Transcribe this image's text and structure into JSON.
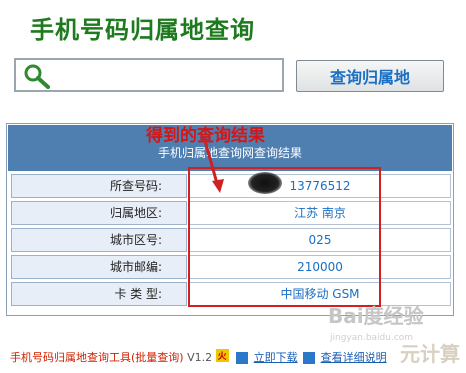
{
  "header": {
    "title": "手机号码归属地查询"
  },
  "search": {
    "value": "",
    "placeholder": "",
    "button_label": "查询归属地"
  },
  "result": {
    "heading": "手机归属地查询网查询结果",
    "rows": [
      {
        "label": "所查号码:",
        "value": "13776512"
      },
      {
        "label": "归属地区:",
        "value": "江苏 南京"
      },
      {
        "label": "城市区号:",
        "value": "025"
      },
      {
        "label": "城市邮编:",
        "value": "210000"
      },
      {
        "label": "卡 类 型:",
        "value": "中国移动 GSM"
      }
    ]
  },
  "annotation": {
    "text": "得到的查询结果",
    "color": "#d02020"
  },
  "footer": {
    "tool_name": "手机号码归属地查询工具(批量查询)",
    "version": "V1.2",
    "badge": "火",
    "download_link": "立即下载",
    "details_link": "查看详细说明"
  },
  "watermark": {
    "text": "Bai度经验",
    "sub": "jingyan.baidu.com",
    "corner": "元计算"
  },
  "colors": {
    "title": "#1e7a1e",
    "header_bg": "#4f7fb1",
    "value_text": "#1a6fc4",
    "accent_red": "#d02020"
  }
}
